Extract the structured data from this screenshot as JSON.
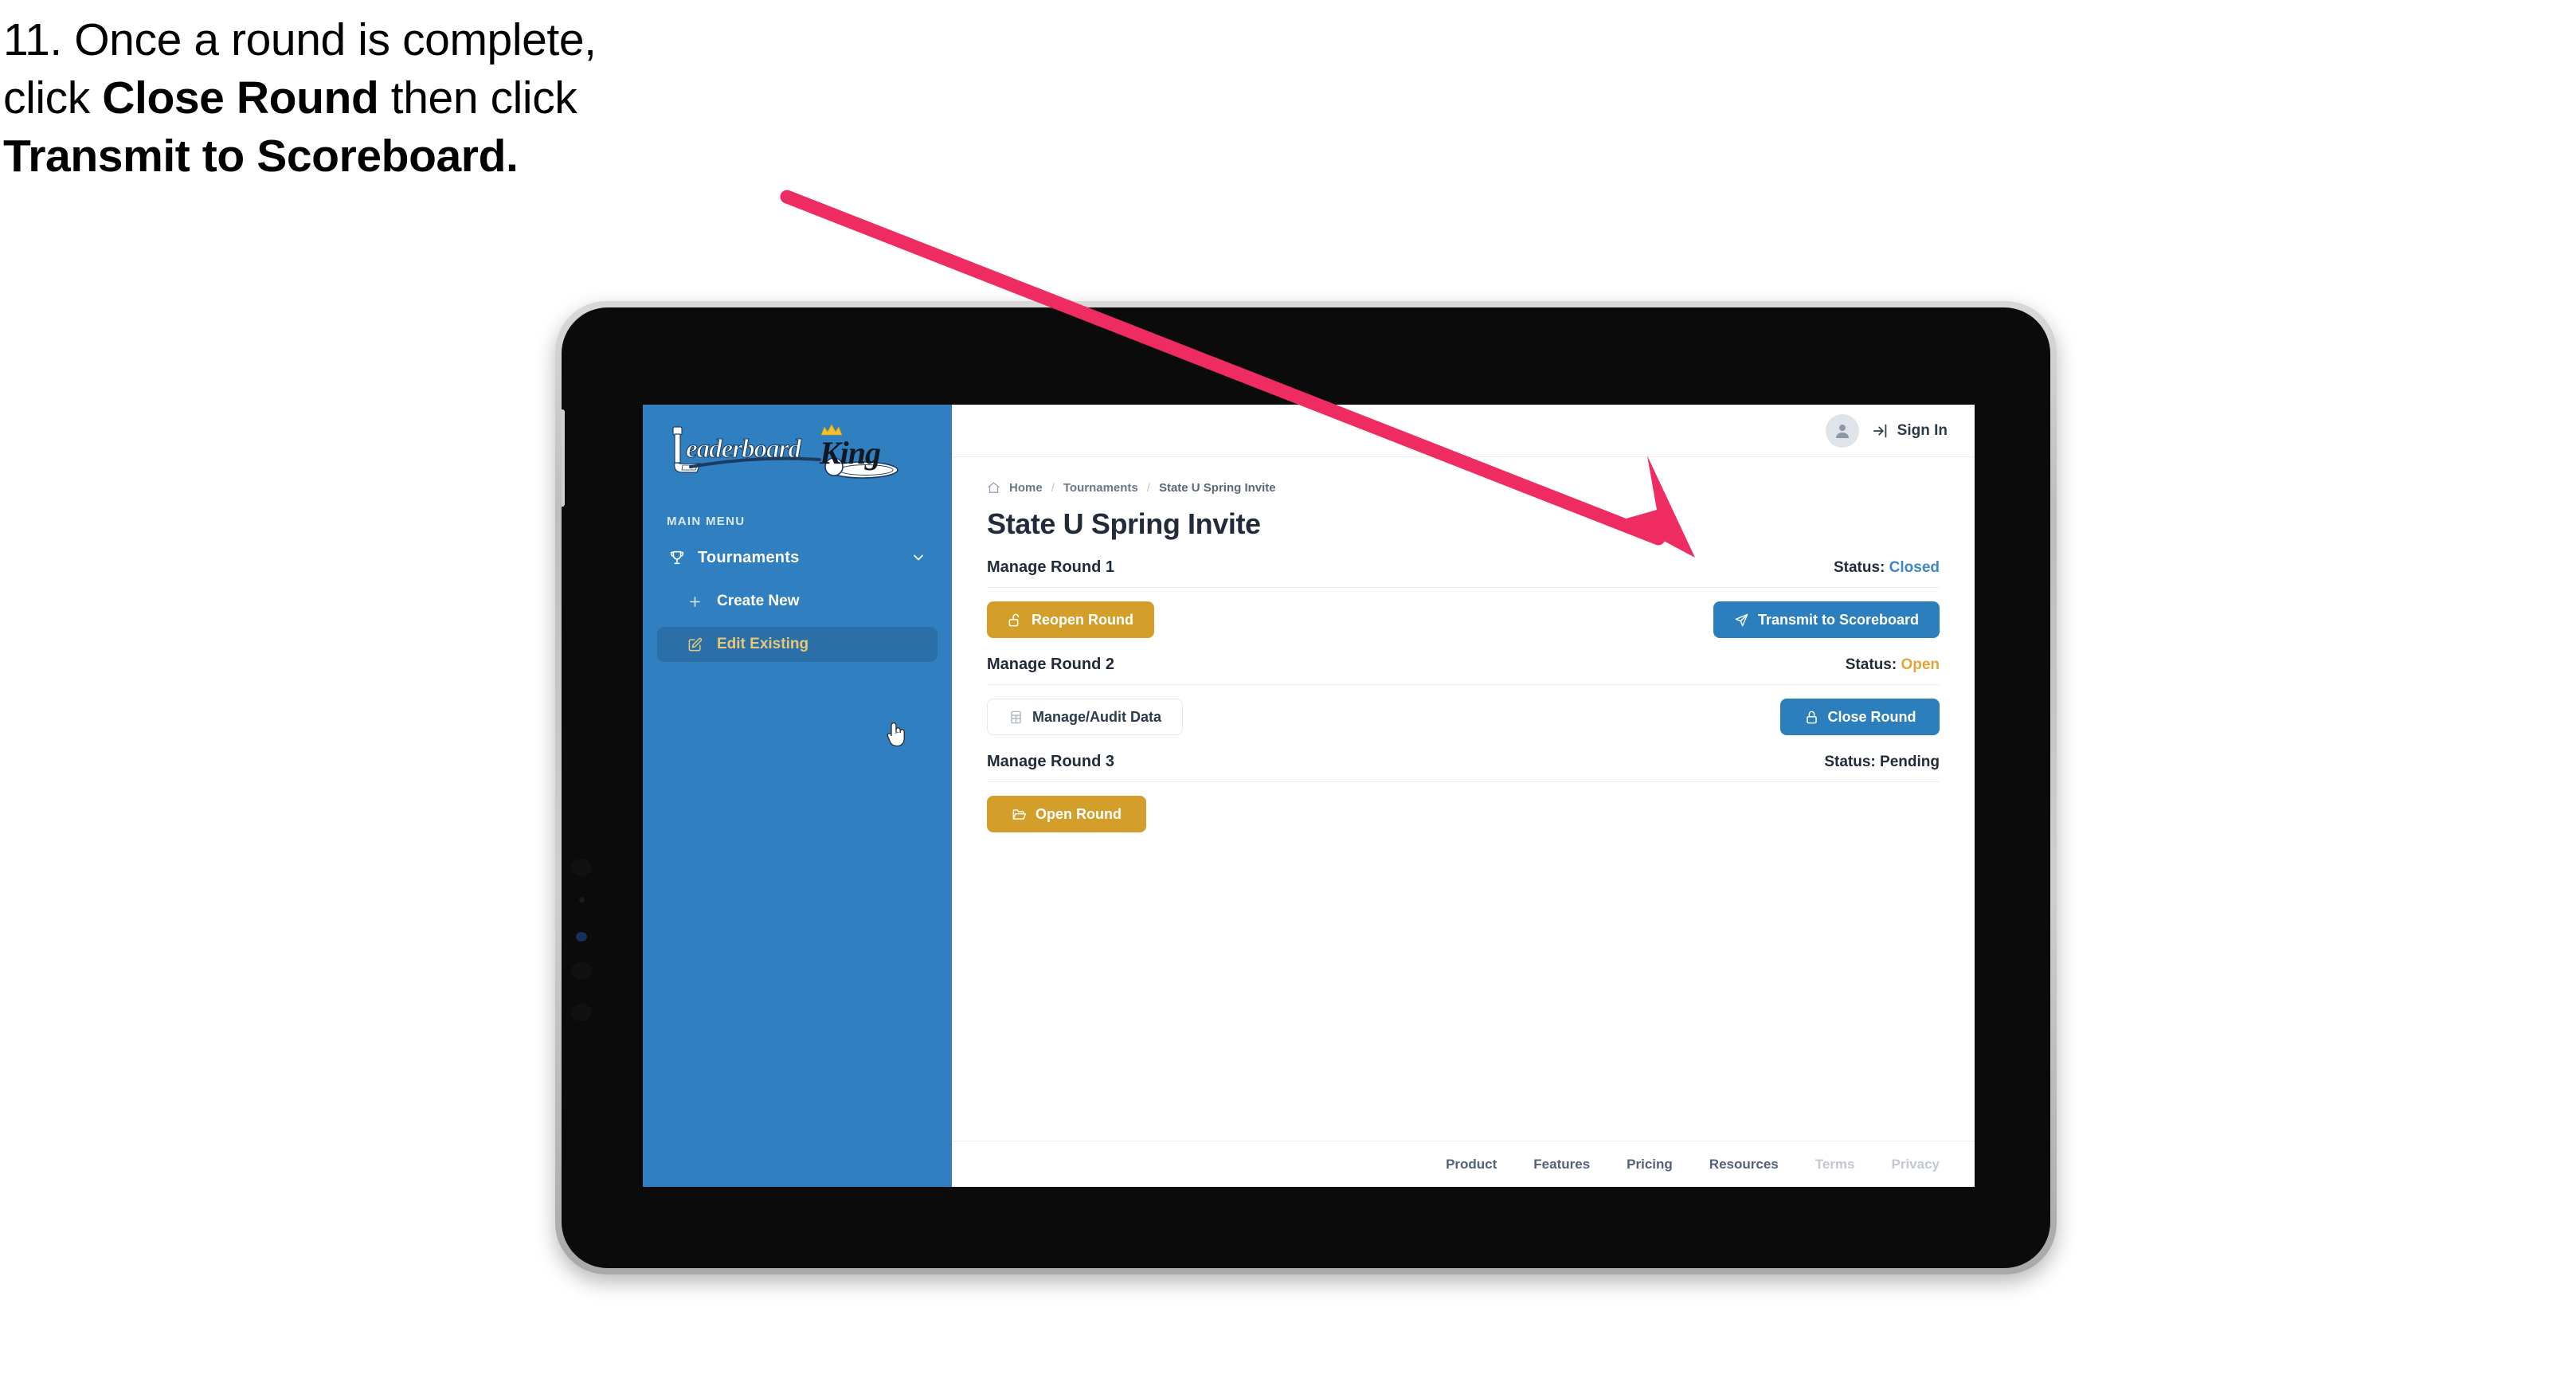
{
  "caption": {
    "line1": "11. Once a round is complete,",
    "line2_pre": "click ",
    "line2_bold": "Close Round",
    "line2_post": " then click",
    "line3_bold": "Transmit to Scoreboard."
  },
  "colors": {
    "sidebar_blue": "#2F7FC1",
    "sidebar_active": "#2A6FA8",
    "active_label_gold": "#E7C878",
    "button_gold": "#D39E2A",
    "button_blue": "#2D7EBD",
    "status_closed_blue": "#3E86C9",
    "status_open_orange": "#E0A63A",
    "status_pending_dark": "#222B3B",
    "arrow_pink": "#EE2C62",
    "screen_text_dark": "#222B3B"
  },
  "sidebar": {
    "logo_text_primary": "Leaderboard",
    "logo_text_secondary": "King",
    "menu_label": "MAIN MENU",
    "items": [
      {
        "label": "Tournaments",
        "icon": "trophy-icon",
        "chevron": "chevron-down-icon",
        "active": false
      },
      {
        "label": "Create New",
        "icon": "plus-icon",
        "active": false
      },
      {
        "label": "Edit Existing",
        "icon": "edit-square-icon",
        "active": true
      }
    ]
  },
  "topbar": {
    "avatar_icon": "user-avatar-icon",
    "signin_icon": "sign-in-arrow-icon",
    "signin_label": "Sign In"
  },
  "breadcrumb": {
    "home_icon": "home-icon",
    "items": [
      "Home",
      "Tournaments",
      "State U Spring Invite"
    ],
    "separator": "/"
  },
  "page": {
    "title": "State U Spring Invite"
  },
  "rounds": [
    {
      "title": "Manage Round 1",
      "status_label": "Status:",
      "status_value": "Closed",
      "status_color": "#3E86C9",
      "left_button": {
        "label": "Reopen Round",
        "icon": "unlock-icon",
        "style": "gold"
      },
      "right_button": {
        "label": "Transmit to Scoreboard",
        "icon": "paper-plane-icon",
        "style": "blue"
      }
    },
    {
      "title": "Manage Round 2",
      "status_label": "Status:",
      "status_value": "Open",
      "status_color": "#E0A63A",
      "left_button": {
        "label": "Manage/Audit Data",
        "icon": "table-grid-icon",
        "style": "ghost"
      },
      "right_button": {
        "label": "Close Round",
        "icon": "lock-icon",
        "style": "blue"
      }
    },
    {
      "title": "Manage Round 3",
      "status_label": "Status:",
      "status_value": "Pending",
      "status_color": "#222B3B",
      "left_button": {
        "label": "Open Round",
        "icon": "folder-open-icon",
        "style": "gold"
      },
      "right_button": null
    }
  ],
  "footer": {
    "links": [
      {
        "label": "Product",
        "dim": false
      },
      {
        "label": "Features",
        "dim": false
      },
      {
        "label": "Pricing",
        "dim": false
      },
      {
        "label": "Resources",
        "dim": false
      },
      {
        "label": "Terms",
        "dim": true
      },
      {
        "label": "Privacy",
        "dim": true
      }
    ]
  },
  "annotation": {
    "arrow_icon": "pointer-arrow-icon",
    "arrow_color": "#EE2C62"
  }
}
